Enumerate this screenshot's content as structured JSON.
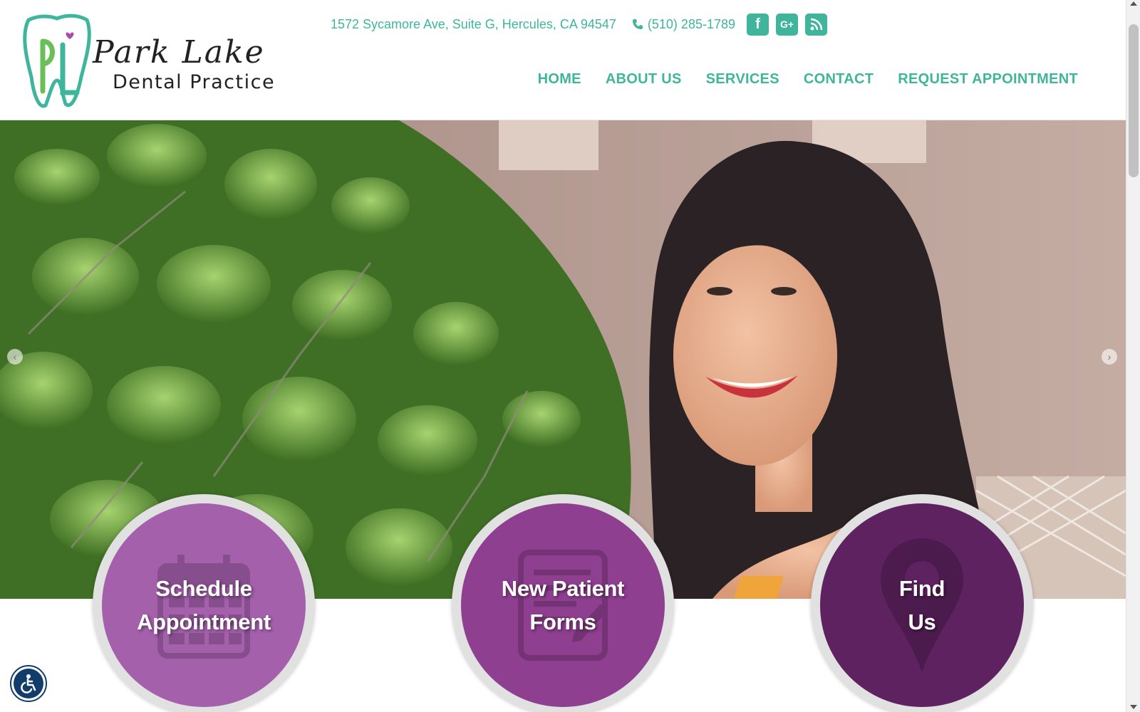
{
  "brand": {
    "name_script": "Park Lake",
    "name_sub": "Dental Practice",
    "logo_mark": "PL",
    "colors": {
      "accent": "#3fb59b",
      "purple_light": "#a560ac",
      "purple_mid": "#8f3f90",
      "purple_dark": "#5e2260",
      "logo_heart": "#b04aa8",
      "logo_green": "#6bbf59"
    }
  },
  "topbar": {
    "address": "1572 Sycamore Ave, Suite G, Hercules, CA 94547",
    "phone": "(510) 285-1789",
    "phone_icon": "phone-icon",
    "social": [
      {
        "icon": "facebook-icon",
        "glyph": "f"
      },
      {
        "icon": "google-plus-icon",
        "glyph": "G+"
      },
      {
        "icon": "rss-icon",
        "glyph": ""
      }
    ]
  },
  "nav": {
    "items": [
      {
        "label": "HOME"
      },
      {
        "label": "ABOUT US"
      },
      {
        "label": "SERVICES"
      },
      {
        "label": "CONTACT"
      },
      {
        "label": "REQUEST APPOINTMENT"
      }
    ]
  },
  "hero": {
    "prev_icon": "chevron-left-icon",
    "next_icon": "chevron-right-icon",
    "prev_glyph": "‹",
    "next_glyph": "›"
  },
  "cta": [
    {
      "line1": "Schedule",
      "line2": "Appointment",
      "icon": "calendar-icon"
    },
    {
      "line1": "New Patient",
      "line2": "Forms",
      "icon": "form-icon"
    },
    {
      "line1": "Find",
      "line2": "Us",
      "icon": "map-pin-icon"
    }
  ],
  "accessibility": {
    "icon": "wheelchair-icon"
  }
}
